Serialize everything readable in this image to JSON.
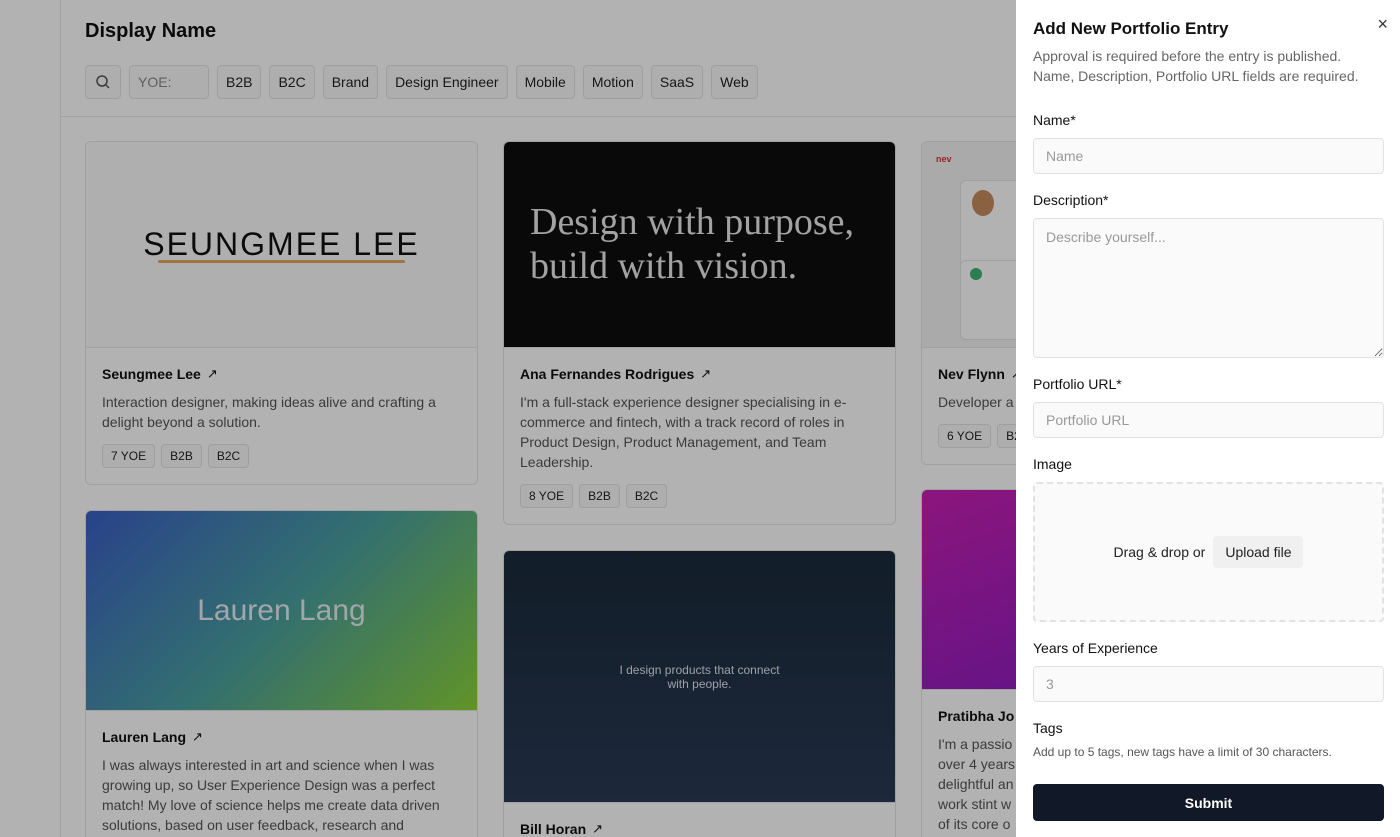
{
  "page": {
    "title": "Display Name"
  },
  "filters": {
    "yoe_placeholder": "YOE:",
    "tags": [
      "B2B",
      "B2C",
      "Brand",
      "Design Engineer",
      "Mobile",
      "Motion",
      "SaaS",
      "Web"
    ]
  },
  "cards": [
    {
      "name": "Seungmee Lee",
      "desc": "Interaction designer, making ideas alive and crafting a delight beyond a solution.",
      "image_text": "SEUNGMEE LEE",
      "tags": [
        "7 YOE",
        "B2B",
        "B2C"
      ]
    },
    {
      "name": "Ana Fernandes Rodrigues",
      "desc": "I'm a full-stack experience designer specialising in e-commerce and fintech, with a track record of roles in Product Design, Product Management, and Team Leadership.",
      "image_text_1": "Design with purpose,",
      "image_text_2": "build with vision.",
      "tags": [
        "8 YOE",
        "B2B",
        "B2C"
      ]
    },
    {
      "name": "Nev Flynn",
      "desc": "Developer a",
      "image_text": "nev",
      "tags": [
        "6 YOE",
        "B2"
      ]
    },
    {
      "name": "Lauren Lang",
      "desc": "I was always interested in art and science when I was growing up, so User Experience Design was a perfect match! My love of science helps me create data driven solutions, based on user feedback, research and",
      "image_text": "Lauren Lang"
    },
    {
      "name": "Bill Horan",
      "image_text_1": "I design products that connect",
      "image_text_2": "with people."
    },
    {
      "name": "Pratibha Jo",
      "desc_lines": [
        "I'm a passio",
        "over 4 years",
        "delightful an",
        "work stint w",
        "of its core o"
      ]
    }
  ],
  "drawer": {
    "title": "Add New Portfolio Entry",
    "close_icon": "×",
    "subtitle_1": "Approval is required before the entry is published.",
    "subtitle_2": "Name, Description, Portfolio URL fields are required.",
    "name_label": "Name*",
    "name_placeholder": "Name",
    "description_label": "Description*",
    "description_placeholder": "Describe yourself...",
    "url_label": "Portfolio URL*",
    "url_placeholder": "Portfolio URL",
    "image_label": "Image",
    "drop_text": "Drag & drop or",
    "upload_label": "Upload file",
    "yoe_label": "Years of Experience",
    "yoe_placeholder": "3",
    "tags_label": "Tags",
    "tags_hint": "Add up to 5 tags, new tags have a limit of 30 characters.",
    "submit_label": "Submit"
  },
  "colors": {
    "primary": "#111827",
    "overlay": "rgba(0,0,0,0.30)"
  }
}
